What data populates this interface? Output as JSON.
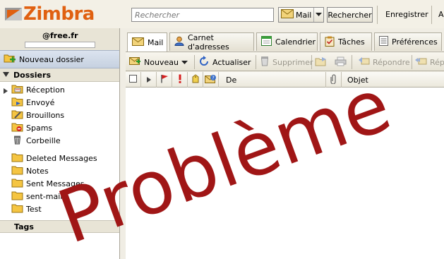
{
  "header": {
    "logo_text": "Zimbra",
    "search_placeholder": "Rechercher",
    "search_type_label": "Mail",
    "search_button_label": "Rechercher",
    "save_search_label": "Enregistrer",
    "more_label": "A"
  },
  "user": {
    "email": "@free.fr"
  },
  "sidebar": {
    "new_folder_label": "Nouveau dossier",
    "folders_header": "Dossiers",
    "folders": [
      {
        "label": "Réception",
        "icon": "inbox-folder-icon"
      },
      {
        "label": "Envoyé",
        "icon": "sent-folder-icon"
      },
      {
        "label": "Brouillons",
        "icon": "drafts-folder-icon"
      },
      {
        "label": "Spams",
        "icon": "spam-folder-icon"
      },
      {
        "label": "Corbeille",
        "icon": "trash-icon"
      },
      {
        "label": "Deleted Messages",
        "icon": "folder-icon"
      },
      {
        "label": "Notes",
        "icon": "folder-icon"
      },
      {
        "label": "Sent Messages",
        "icon": "folder-icon"
      },
      {
        "label": "sent-mail",
        "icon": "folder-icon"
      },
      {
        "label": "Test",
        "icon": "folder-icon"
      }
    ],
    "tags_header": "Tags"
  },
  "tabs": [
    {
      "label": "Mail",
      "active": true
    },
    {
      "label": "Carnet d'adresses",
      "active": false
    },
    {
      "label": "Calendrier",
      "active": false
    },
    {
      "label": "Tâches",
      "active": false
    },
    {
      "label": "Préférences",
      "active": false
    }
  ],
  "toolbar": {
    "new_label": "Nouveau",
    "refresh_label": "Actualiser",
    "delete_label": "Supprimer",
    "reply_label": "Répondre",
    "reply_all_label": "Rép"
  },
  "list_header": {
    "from_label": "De",
    "subject_label": "Objet"
  },
  "overlay": {
    "text": "Problème",
    "color": "#a01616"
  }
}
